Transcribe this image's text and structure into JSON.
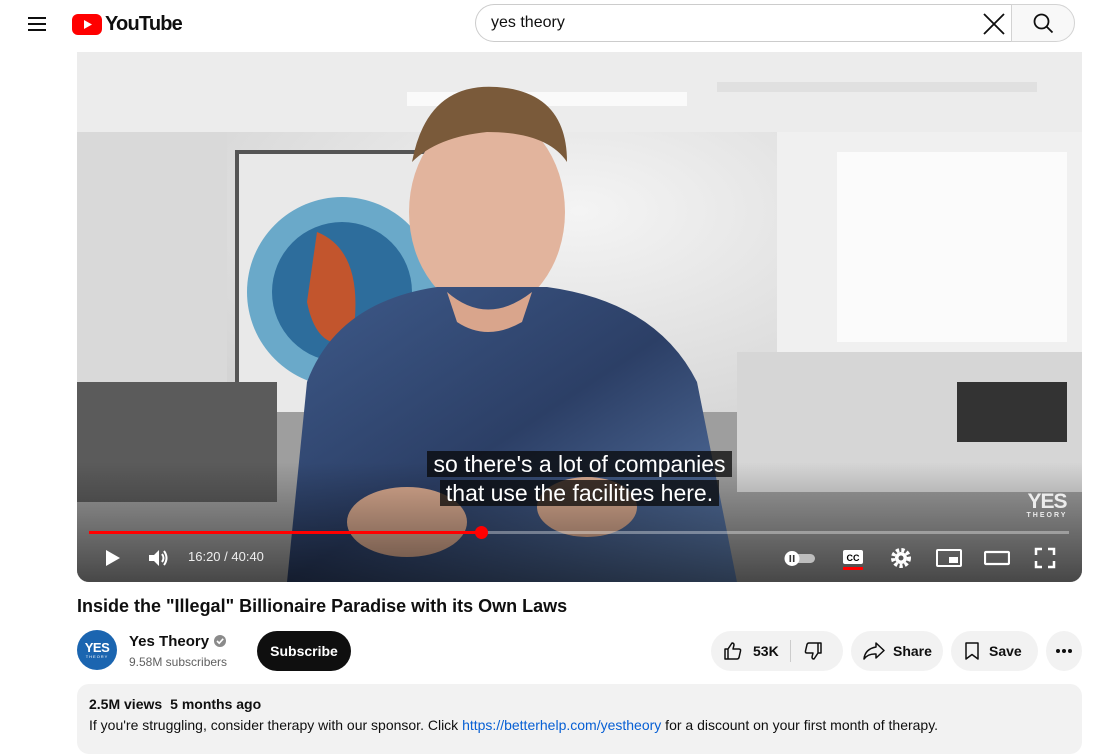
{
  "header": {
    "logo_text": "YouTube",
    "search": {
      "value": "yes theory",
      "placeholder": "Search"
    },
    "icons": {
      "menu": "hamburger-menu-icon",
      "clear": "close-icon",
      "search": "search-icon"
    }
  },
  "player": {
    "caption_line1": "so there's a lot of companies",
    "caption_line2": "that use the facilities here.",
    "watermark_big": "YES",
    "watermark_small": "THEORY",
    "current_time": "16:20",
    "duration": "40:40",
    "time_display": "16:20 / 40:40",
    "progress_fraction": 0.4,
    "accent_color": "#ff0000"
  },
  "video": {
    "title": "Inside the \"Illegal\" Billionaire Paradise with its Own Laws"
  },
  "channel": {
    "name": "Yes Theory",
    "subscribers": "9.58M subscribers",
    "avatar_text": "YES",
    "avatar_subtext": "THEORY",
    "subscribe_label": "Subscribe"
  },
  "actions": {
    "like_count": "53K",
    "share_label": "Share",
    "save_label": "Save"
  },
  "description": {
    "views": "2.5M views",
    "age": "5 months ago",
    "text_before": "If you're struggling, consider therapy with our sponsor. Click ",
    "link": "https://betterhelp.com/yestheory",
    "text_after": " for a discount on your first month of therapy."
  }
}
